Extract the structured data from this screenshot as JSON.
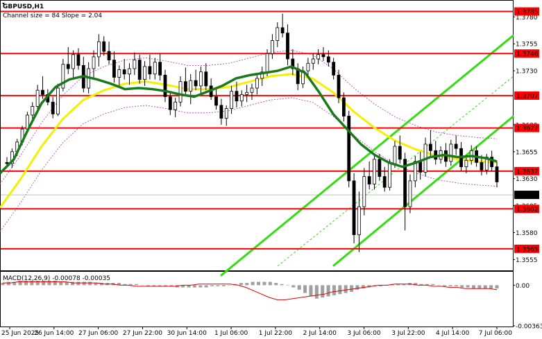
{
  "header": {
    "symbol": "GBPUSD,H1",
    "channel_info": "Channel size = 84 Slope = 2.04",
    "macd_label": "MACD(12,26,9) -0.00078 -0.00035"
  },
  "colors": {
    "level_line": "#ff0000",
    "level_tag_bg": "#ff0000",
    "candle": "#000000",
    "ma_fast": "#1a7a1a",
    "ma_slow": "#f5f000",
    "channel": "#33dd11",
    "envelope": "#aa33cc",
    "macd_hist": "#a0a0a0",
    "macd_signal": "#dd0000",
    "current_tag_bg": "#000000"
  },
  "chart_data": {
    "type": "candlestick",
    "ylim": [
      1.3545,
      1.3795
    ],
    "price_ticks": [
      "1.3780",
      "1.3755",
      "1.3730",
      "1.3680",
      "1.3655",
      "1.3630",
      "1.3605",
      "1.3580",
      "1.3555"
    ],
    "time_ticks": [
      "25 Jun 2025",
      "26 Jun 14:00",
      "27 Jun 06:00",
      "27 Jun 22:00",
      "30 Jun 14:00",
      "1 Jul 06:00",
      "1 Jul 22:00",
      "2 Jul 14:00",
      "3 Jul 06:00",
      "3 Jul 22:00",
      "4 Jul 14:00",
      "7 Jul 06:00"
    ],
    "levels": [
      {
        "label": "1.3785",
        "value": 1.3785
      },
      {
        "label": "1.3746",
        "value": 1.3746
      },
      {
        "label": "1.3707",
        "value": 1.3707
      },
      {
        "label": "1.3677",
        "value": 1.3677
      },
      {
        "label": "1.3637",
        "value": 1.3637
      },
      {
        "label": "1.3602",
        "value": 1.3602
      },
      {
        "label": "1.3565",
        "value": 1.3565
      }
    ],
    "current_price": {
      "label": "1.3615",
      "value": 1.3615
    },
    "ma_fast": [
      [
        0,
        1.3635
      ],
      [
        20,
        1.3648
      ],
      [
        40,
        1.3675
      ],
      [
        60,
        1.37
      ],
      [
        80,
        1.3715
      ],
      [
        100,
        1.3722
      ],
      [
        120,
        1.3725
      ],
      [
        140,
        1.3722
      ],
      [
        160,
        1.3718
      ],
      [
        180,
        1.3713
      ],
      [
        200,
        1.3714
      ],
      [
        220,
        1.3713
      ],
      [
        240,
        1.3711
      ],
      [
        260,
        1.3708
      ],
      [
        280,
        1.3706
      ],
      [
        300,
        1.3711
      ],
      [
        320,
        1.3716
      ],
      [
        340,
        1.3723
      ],
      [
        360,
        1.3726
      ],
      [
        380,
        1.3728
      ],
      [
        400,
        1.373
      ],
      [
        420,
        1.3734
      ],
      [
        440,
        1.3728
      ],
      [
        460,
        1.371
      ],
      [
        480,
        1.369
      ],
      [
        500,
        1.3676
      ],
      [
        520,
        1.3662
      ],
      [
        540,
        1.3652
      ],
      [
        560,
        1.3645
      ],
      [
        580,
        1.3641
      ],
      [
        600,
        1.3645
      ],
      [
        620,
        1.365
      ],
      [
        640,
        1.3652
      ],
      [
        660,
        1.365
      ],
      [
        680,
        1.3651
      ],
      [
        700,
        1.3649
      ],
      [
        716,
        1.3646
      ]
    ],
    "ma_slow": [
      [
        0,
        1.3603
      ],
      [
        30,
        1.363
      ],
      [
        60,
        1.366
      ],
      [
        90,
        1.3685
      ],
      [
        120,
        1.3703
      ],
      [
        150,
        1.3712
      ],
      [
        180,
        1.3718
      ],
      [
        210,
        1.372
      ],
      [
        240,
        1.3717
      ],
      [
        270,
        1.3713
      ],
      [
        300,
        1.3713
      ],
      [
        330,
        1.3715
      ],
      [
        360,
        1.372
      ],
      [
        390,
        1.3725
      ],
      [
        420,
        1.3727
      ],
      [
        450,
        1.3723
      ],
      [
        480,
        1.371
      ],
      [
        510,
        1.3692
      ],
      [
        540,
        1.3677
      ],
      [
        570,
        1.3665
      ],
      [
        600,
        1.3657
      ],
      [
        630,
        1.3651
      ],
      [
        660,
        1.3648
      ],
      [
        690,
        1.3646
      ],
      [
        716,
        1.3645
      ]
    ],
    "channel_lines": [
      {
        "style": "solid",
        "points": [
          [
            318,
            1.354
          ],
          [
            740,
            1.3763
          ]
        ]
      },
      {
        "style": "solid",
        "points": [
          [
            480,
            1.3549
          ],
          [
            740,
            1.3688
          ]
        ]
      },
      {
        "style": "dashed",
        "points": [
          [
            400,
            1.3549
          ],
          [
            740,
            1.3725
          ]
        ]
      }
    ],
    "candles": [
      [
        1.3645,
        1.365,
        1.3641,
        1.3644
      ],
      [
        1.3644,
        1.3658,
        1.364,
        1.3655
      ],
      [
        1.3655,
        1.3667,
        1.3651,
        1.3664
      ],
      [
        1.3664,
        1.3679,
        1.3661,
        1.3676
      ],
      [
        1.3676,
        1.3692,
        1.3673,
        1.3689
      ],
      [
        1.3689,
        1.3701,
        1.3684,
        1.3697
      ],
      [
        1.3697,
        1.3717,
        1.3694,
        1.3712
      ],
      [
        1.3712,
        1.3725,
        1.3704,
        1.3708
      ],
      [
        1.3708,
        1.3713,
        1.3698,
        1.3701
      ],
      [
        1.3701,
        1.3706,
        1.3686,
        1.369
      ],
      [
        1.369,
        1.3718,
        1.3688,
        1.3714
      ],
      [
        1.3714,
        1.3741,
        1.3711,
        1.3736
      ],
      [
        1.3736,
        1.3752,
        1.3727,
        1.3732
      ],
      [
        1.3732,
        1.3749,
        1.3724,
        1.3745
      ],
      [
        1.3745,
        1.3751,
        1.3731,
        1.3735
      ],
      [
        1.3735,
        1.3743,
        1.371,
        1.3714
      ],
      [
        1.3714,
        1.3738,
        1.3709,
        1.3732
      ],
      [
        1.3732,
        1.3749,
        1.3722,
        1.3743
      ],
      [
        1.3743,
        1.3764,
        1.3734,
        1.3757
      ],
      [
        1.3757,
        1.3762,
        1.3744,
        1.3748
      ],
      [
        1.3748,
        1.3757,
        1.3736,
        1.374
      ],
      [
        1.374,
        1.3748,
        1.3719,
        1.3724
      ],
      [
        1.3724,
        1.3735,
        1.3716,
        1.3731
      ],
      [
        1.3731,
        1.3741,
        1.3722,
        1.3727
      ],
      [
        1.3727,
        1.3737,
        1.3717,
        1.3732
      ],
      [
        1.3732,
        1.3747,
        1.3726,
        1.374
      ],
      [
        1.374,
        1.3745,
        1.3718,
        1.3722
      ],
      [
        1.3722,
        1.3739,
        1.3716,
        1.3734
      ],
      [
        1.3734,
        1.3745,
        1.3722,
        1.3727
      ],
      [
        1.3727,
        1.3742,
        1.3722,
        1.3738
      ],
      [
        1.3738,
        1.3746,
        1.3721,
        1.3726
      ],
      [
        1.3726,
        1.3731,
        1.3701,
        1.3706
      ],
      [
        1.3706,
        1.3711,
        1.3689,
        1.3694
      ],
      [
        1.3694,
        1.3705,
        1.3687,
        1.3701
      ],
      [
        1.3701,
        1.3725,
        1.3697,
        1.372
      ],
      [
        1.372,
        1.3733,
        1.3707,
        1.3711
      ],
      [
        1.3711,
        1.3727,
        1.3699,
        1.3721
      ],
      [
        1.3721,
        1.3731,
        1.3712,
        1.3716
      ],
      [
        1.3716,
        1.3734,
        1.3709,
        1.3729
      ],
      [
        1.3729,
        1.3737,
        1.3712,
        1.3716
      ],
      [
        1.3716,
        1.3723,
        1.3703,
        1.3706
      ],
      [
        1.3706,
        1.3714,
        1.3694,
        1.3698
      ],
      [
        1.3698,
        1.3704,
        1.368,
        1.3686
      ],
      [
        1.3686,
        1.3698,
        1.3679,
        1.3695
      ],
      [
        1.3695,
        1.3716,
        1.369,
        1.3711
      ],
      [
        1.3711,
        1.372,
        1.3696,
        1.3702
      ],
      [
        1.3702,
        1.3712,
        1.3697,
        1.3708
      ],
      [
        1.3708,
        1.3717,
        1.3701,
        1.371
      ],
      [
        1.371,
        1.3718,
        1.3703,
        1.3714
      ],
      [
        1.3714,
        1.3727,
        1.3708,
        1.3723
      ],
      [
        1.3723,
        1.3734,
        1.3716,
        1.3729
      ],
      [
        1.3729,
        1.375,
        1.3725,
        1.3746
      ],
      [
        1.3746,
        1.3764,
        1.3741,
        1.3758
      ],
      [
        1.3758,
        1.3775,
        1.3752,
        1.377
      ],
      [
        1.377,
        1.3783,
        1.3761,
        1.3765
      ],
      [
        1.3765,
        1.3773,
        1.3735,
        1.3741
      ],
      [
        1.3741,
        1.375,
        1.3726,
        1.3732
      ],
      [
        1.3732,
        1.3737,
        1.3712,
        1.3718
      ],
      [
        1.3718,
        1.3734,
        1.3714,
        1.373
      ],
      [
        1.373,
        1.3742,
        1.3725,
        1.3737
      ],
      [
        1.3737,
        1.3746,
        1.3731,
        1.3741
      ],
      [
        1.3741,
        1.375,
        1.3736,
        1.3745
      ],
      [
        1.3745,
        1.3752,
        1.3739,
        1.3743
      ],
      [
        1.3743,
        1.3749,
        1.3734,
        1.3738
      ],
      [
        1.3738,
        1.3742,
        1.3722,
        1.3726
      ],
      [
        1.3726,
        1.3731,
        1.37,
        1.3705
      ],
      [
        1.3705,
        1.371,
        1.3683,
        1.3688
      ],
      [
        1.3688,
        1.3693,
        1.3622,
        1.3628
      ],
      [
        1.3628,
        1.3635,
        1.357,
        1.3578
      ],
      [
        1.3578,
        1.3618,
        1.3562,
        1.3604
      ],
      [
        1.3604,
        1.364,
        1.3596,
        1.3632
      ],
      [
        1.3632,
        1.3646,
        1.362,
        1.3625
      ],
      [
        1.3625,
        1.3652,
        1.362,
        1.3648
      ],
      [
        1.3648,
        1.3653,
        1.3628,
        1.3632
      ],
      [
        1.3632,
        1.3641,
        1.3618,
        1.3622
      ],
      [
        1.3622,
        1.3648,
        1.3619,
        1.3644
      ],
      [
        1.3644,
        1.3665,
        1.364,
        1.366
      ],
      [
        1.366,
        1.367,
        1.3644,
        1.3648
      ],
      [
        1.3648,
        1.3654,
        1.3582,
        1.3604
      ],
      [
        1.3604,
        1.3634,
        1.3598,
        1.3628
      ],
      [
        1.3628,
        1.3651,
        1.3622,
        1.3646
      ],
      [
        1.3646,
        1.3655,
        1.3629,
        1.3636
      ],
      [
        1.3636,
        1.3668,
        1.3632,
        1.3662
      ],
      [
        1.3662,
        1.3675,
        1.365,
        1.3656
      ],
      [
        1.3656,
        1.3665,
        1.3643,
        1.3648
      ],
      [
        1.3648,
        1.366,
        1.3644,
        1.3656
      ],
      [
        1.3656,
        1.3663,
        1.3641,
        1.3646
      ],
      [
        1.3646,
        1.3666,
        1.3642,
        1.3662
      ],
      [
        1.3662,
        1.367,
        1.3652,
        1.3658
      ],
      [
        1.3658,
        1.3664,
        1.3637,
        1.3641
      ],
      [
        1.3641,
        1.3652,
        1.3635,
        1.3647
      ],
      [
        1.3647,
        1.3661,
        1.3643,
        1.3656
      ],
      [
        1.3656,
        1.366,
        1.3641,
        1.3645
      ],
      [
        1.3645,
        1.3652,
        1.3633,
        1.3638
      ],
      [
        1.3638,
        1.3653,
        1.3634,
        1.365
      ],
      [
        1.365,
        1.3656,
        1.3637,
        1.3641
      ],
      [
        1.3641,
        1.3646,
        1.3622,
        1.3627
      ]
    ],
    "macd": {
      "ylim": [
        -0.00363,
        0.0012
      ],
      "ticks": [
        "0.00",
        "-0.00363"
      ],
      "hist": [
        0.0002,
        0.0003,
        0.0003,
        0.0004,
        0.0004,
        0.0004,
        0.0004,
        0.0004,
        0.0004,
        0.0004,
        0.0003,
        0.0003,
        0.0003,
        0.0003,
        0.0003,
        0.0003,
        0.0002,
        0.0002,
        0.0002,
        0.0002,
        0.0002,
        0.0001,
        0.0001,
        0.0001,
        0.0,
        -0.0001,
        -0.0001,
        -0.0001,
        -0.0001,
        -0.0001,
        -0.0002,
        -0.0002,
        -0.0002,
        -0.0002,
        -0.0002,
        -0.0002,
        -0.0001,
        -0.0001,
        -0.0001,
        0.0,
        0.0001,
        0.0002,
        0.0002,
        0.0003,
        0.0003,
        0.0003,
        0.0003,
        0.0002,
        0.0001,
        0.0,
        -0.0002,
        -0.0004,
        -0.0007,
        -0.001,
        -0.0012,
        -0.0011,
        -0.001,
        -0.0009,
        -0.0008,
        -0.0007,
        -0.0006,
        -0.0004,
        -0.0003,
        -0.0002,
        -0.0001,
        -0.0001,
        0.0,
        0.0001,
        0.0001,
        0.0001,
        0.0002,
        0.0002,
        0.0001,
        0.0001,
        0.0001,
        0.0,
        -0.0001,
        -0.0001,
        -0.0001,
        -0.0002,
        -0.0002,
        -0.0003,
        -0.0003,
        -0.0003,
        -0.0003,
        -0.0003
      ],
      "signal": [
        0.0002,
        0.0002,
        0.0003,
        0.0003,
        0.0003,
        0.0003,
        0.0003,
        0.0003,
        0.0003,
        0.0002,
        0.0002,
        0.0002,
        0.0002,
        0.0001,
        0.0001,
        0.0,
        0.0,
        -0.0001,
        -0.0001,
        -0.0001,
        -0.0001,
        -0.0001,
        -0.0001,
        0.0,
        0.0,
        0.0001,
        0.0001,
        0.0001,
        0.0001,
        0.0001,
        0.0,
        -0.0002,
        -0.0005,
        -0.0008,
        -0.0011,
        -0.0013,
        -0.0013,
        -0.0012,
        -0.0011,
        -0.001,
        -0.0009,
        -0.0008,
        -0.0006,
        -0.0005,
        -0.0004,
        -0.0003,
        -0.0002,
        -0.0001,
        0.0,
        0.0,
        0.0001,
        0.0001,
        0.0001,
        0.0,
        0.0,
        -0.0001,
        -0.0001,
        -0.0002,
        -0.0002,
        -0.0003,
        -0.0003,
        -0.0003,
        -0.0003,
        -0.0004
      ]
    }
  }
}
